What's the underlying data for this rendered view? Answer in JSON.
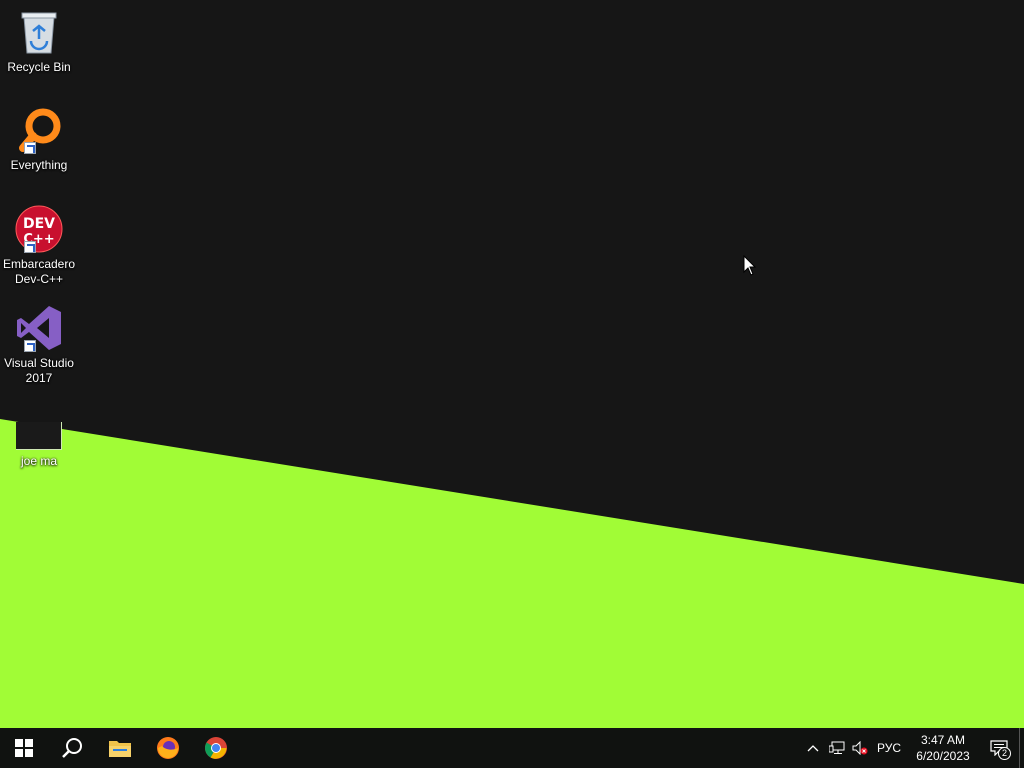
{
  "desktop": {
    "icons": [
      {
        "label": "Recycle Bin",
        "icon": "recycle-bin-icon"
      },
      {
        "label": "Everything",
        "icon": "everything-search-icon",
        "shortcut": true
      },
      {
        "label": "Embarcadero Dev-C++",
        "icon": "devcpp-icon",
        "badge": "DEV C++",
        "shortcut": true
      },
      {
        "label": "Visual Studio 2017",
        "icon": "visual-studio-icon",
        "shortcut": true
      },
      {
        "label": "joe ma",
        "icon": "folder-icon"
      }
    ]
  },
  "taskbar": {
    "start": "windows-logo-icon",
    "search": "search-icon",
    "pinned": [
      "file-explorer-icon",
      "firefox-icon",
      "chrome-icon"
    ],
    "tray": {
      "language": "РУС",
      "time": "3:47 AM",
      "date": "6/20/2023",
      "notification_count": "2"
    }
  },
  "colors": {
    "wallpaper_dark": "#161616",
    "wallpaper_green": "#a1fc36",
    "taskbar": "#101210"
  }
}
